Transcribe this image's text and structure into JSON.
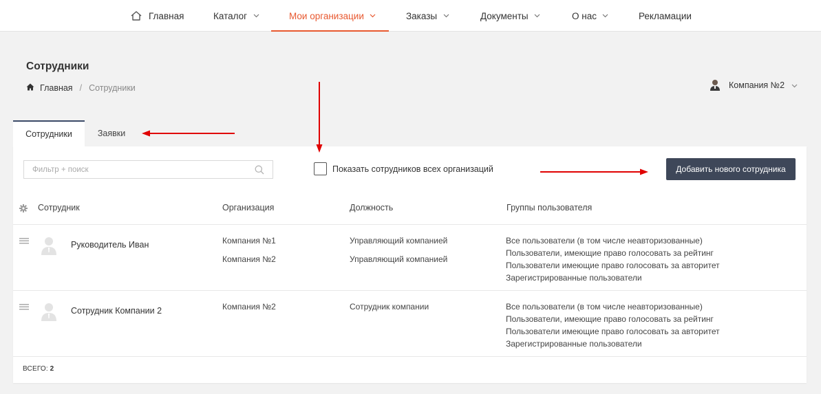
{
  "nav": {
    "home": "Главная",
    "catalog": "Каталог",
    "my_orgs": "Мои организации",
    "orders": "Заказы",
    "documents": "Документы",
    "about": "О нас",
    "claims": "Рекламации"
  },
  "page": {
    "title": "Сотрудники",
    "breadcrumb_home": "Главная",
    "breadcrumb_sep": "/",
    "breadcrumb_current": "Сотрудники"
  },
  "company_selector": {
    "label": "Компания №2"
  },
  "tabs": [
    {
      "label": "Сотрудники",
      "active": true
    },
    {
      "label": "Заявки",
      "active": false
    }
  ],
  "toolbar": {
    "search_placeholder": "Фильтр + поиск",
    "show_all_label": "Показать сотрудников всех организаций",
    "show_all_checked": false,
    "add_button": "Добавить нового сотрудника"
  },
  "table": {
    "columns": [
      "Сотрудник",
      "Организация",
      "Должность",
      "Группы пользователя"
    ],
    "rows": [
      {
        "name": "Руководитель Иван",
        "orgs": [
          "Компания №1",
          "Компания №2"
        ],
        "positions": [
          "Управляющий компанией",
          "Управляющий компанией"
        ],
        "groups": [
          "Все пользователи (в том числе неавторизованные)",
          "Пользователи, имеющие право голосовать за рейтинг",
          "Пользователи имеющие право голосовать за авторитет",
          "Зарегистрированные пользователи"
        ]
      },
      {
        "name": "Сотрудник Компании 2",
        "orgs": [
          "Компания №2"
        ],
        "positions": [
          "Сотрудник компании"
        ],
        "groups": [
          "Все пользователи (в том числе неавторизованные)",
          "Пользователи, имеющие право голосовать за рейтинг",
          "Пользователи имеющие право голосовать за авторитет",
          "Зарегистрированные пользователи"
        ]
      }
    ]
  },
  "footer": {
    "total_label": "Всего:",
    "total_value": "2"
  },
  "colors": {
    "accent": "#e8582f",
    "button_bg": "#3e4759",
    "annotation_arrow": "#e00000"
  }
}
